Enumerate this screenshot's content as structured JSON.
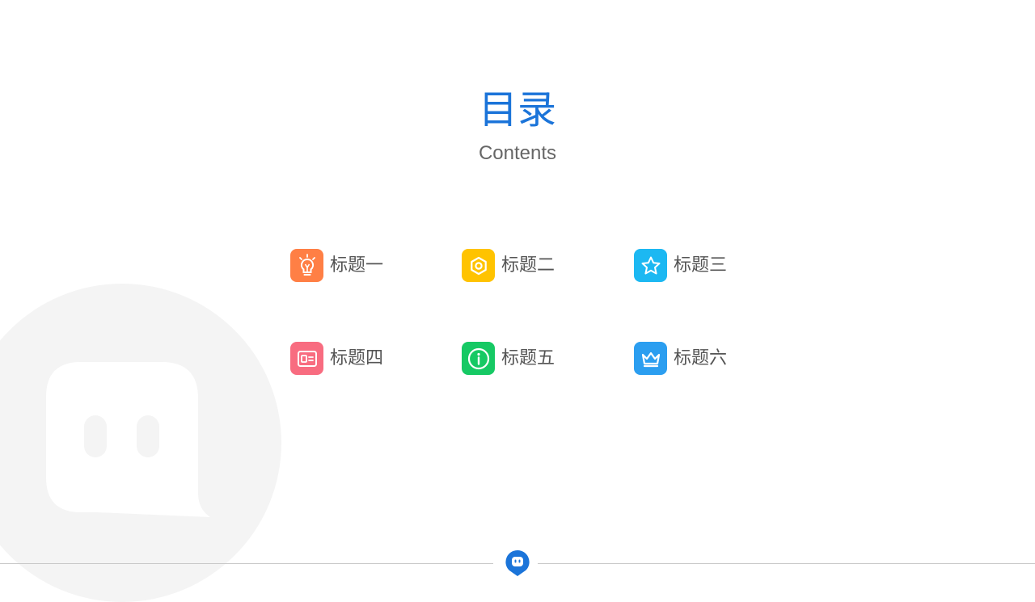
{
  "header": {
    "title": "目录",
    "subtitle": "Contents"
  },
  "items": [
    {
      "label": "标题一",
      "icon": "lightbulb-icon",
      "color": "#ff7f45"
    },
    {
      "label": "标题二",
      "icon": "hexagon-nut-icon",
      "color": "#ffc300"
    },
    {
      "label": "标题三",
      "icon": "star-icon",
      "color": "#1cb8f2"
    },
    {
      "label": "标题四",
      "icon": "id-card-icon",
      "color": "#f86c80"
    },
    {
      "label": "标题五",
      "icon": "info-icon",
      "color": "#16c964"
    },
    {
      "label": "标题六",
      "icon": "crown-icon",
      "color": "#2b9ef0"
    }
  ],
  "theme": {
    "accent": "#1b74d9",
    "background_circle": "#f4f4f4",
    "text": "#555555"
  }
}
